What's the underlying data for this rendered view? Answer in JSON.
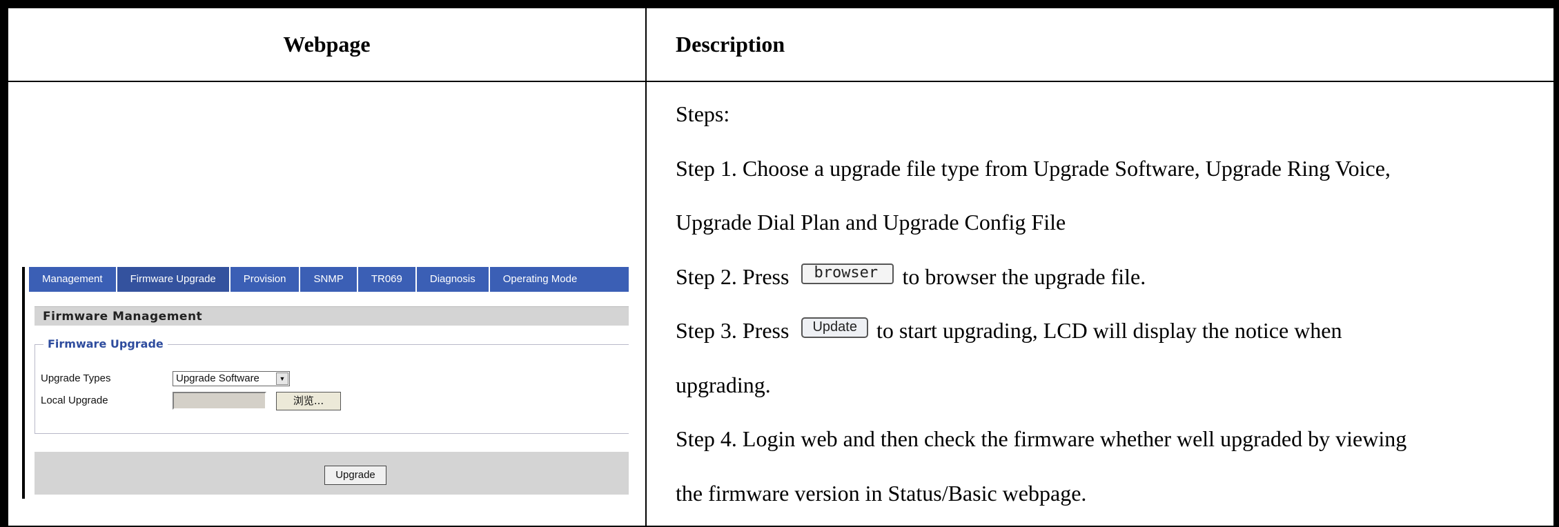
{
  "table": {
    "header_webpage": "Webpage",
    "header_description": "Description"
  },
  "screenshot": {
    "tabs": [
      "Management",
      "Firmware Upgrade",
      "Provision",
      "SNMP",
      "TR069",
      "Diagnosis",
      "Operating Mode"
    ],
    "active_tab": "Firmware Upgrade",
    "section_title": "Firmware Management",
    "fieldset_legend": "Firmware Upgrade",
    "upgrade_types_label": "Upgrade Types",
    "upgrade_types_value": "Upgrade Software",
    "local_upgrade_label": "Local Upgrade",
    "browse_button": "浏览...",
    "upgrade_button": "Upgrade"
  },
  "description": {
    "steps_heading": "Steps:",
    "step1_line1": "Step 1. Choose a upgrade file type from Upgrade Software, Upgrade Ring Voice,",
    "step1_line2": "Upgrade Dial Plan and Upgrade Config File",
    "step2_before": "Step 2. Press",
    "step2_button": "browser",
    "step2_after": "to browser the upgrade file.",
    "step3_before": "Step 3. Press",
    "step3_button": "Update",
    "step3_after": "to start upgrading, LCD will display the notice when",
    "step3_line2": "upgrading.",
    "step4_line1": "Step 4. Login web and then check the firmware whether well upgraded by viewing",
    "step4_line2": "the firmware version in Status/Basic webpage."
  }
}
